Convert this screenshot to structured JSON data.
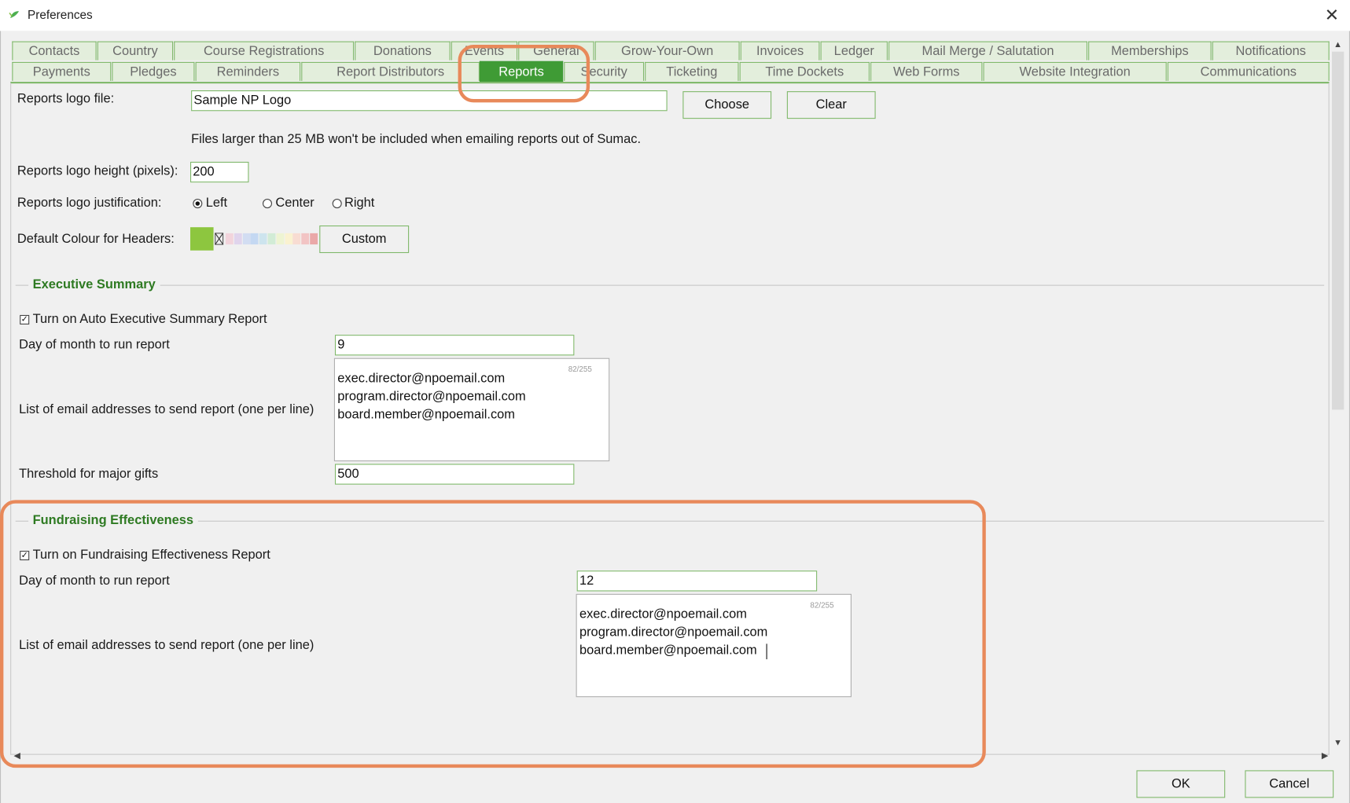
{
  "window": {
    "title": "Preferences",
    "close_glyph": "✕"
  },
  "tabs_row1": [
    "Contacts",
    "Country",
    "Course Registrations",
    "Donations",
    "Events",
    "General",
    "Grow-Your-Own",
    "Invoices",
    "Ledger",
    "Mail Merge / Salutation",
    "Memberships",
    "Notifications"
  ],
  "tabs_row2": [
    "Payments",
    "Pledges",
    "Reminders",
    "Report Distributors",
    "Reports",
    "Security",
    "Ticketing",
    "Time Dockets",
    "Web Forms",
    "Website Integration",
    "Communications"
  ],
  "active_tab": "Reports",
  "logo": {
    "file_label": "Reports logo file:",
    "file_value": "Sample NP Logo",
    "choose_label": "Choose",
    "clear_label": "Clear",
    "size_note": "Files larger than 25 MB won't be included when emailing reports out of Sumac.",
    "height_label": "Reports logo height (pixels):",
    "height_value": "200",
    "justification_label": "Reports logo justification:",
    "justification_options": [
      "Left",
      "Center",
      "Right"
    ],
    "justification_selected": "Left"
  },
  "header_colour": {
    "label": "Default Colour for Headers:",
    "selected_colour": "#8dc63f",
    "palette": [
      "#f2d4dc",
      "#e0d4ec",
      "#d2ddf2",
      "#c4d8f2",
      "#cde4ee",
      "#d2ecd6",
      "#eef4d2",
      "#faf2d0",
      "#f8dcd2",
      "#f2c4c4",
      "#eaa8a8"
    ],
    "custom_label": "Custom"
  },
  "executive_summary": {
    "title": "Executive Summary",
    "toggle_label": "Turn on Auto Executive Summary Report",
    "checked": true,
    "day_label": "Day of month to run report",
    "day_value": "9",
    "emails_label": "List of email addresses to send report (one per line)",
    "emails": [
      "exec.director@npoemail.com",
      "program.director@npoemail.com",
      "board.member@npoemail.com"
    ],
    "counter": "82/255",
    "threshold_label": "Threshold for major gifts",
    "threshold_value": "500"
  },
  "fundraising_effectiveness": {
    "title": "Fundraising Effectiveness",
    "toggle_label": "Turn on Fundraising Effectiveness Report",
    "checked": true,
    "day_label": "Day of month to run report",
    "day_value": "12",
    "emails_label": "List of email addresses to send report (one per line)",
    "emails": [
      "exec.director@npoemail.com",
      "program.director@npoemail.com",
      "board.member@npoemail.com"
    ],
    "counter": "82/255"
  },
  "footer": {
    "ok_label": "OK",
    "cancel_label": "Cancel"
  },
  "colors": {
    "accent": "#3f9b35",
    "tab_border": "#7fb86a",
    "highlight": "#e8895a",
    "section_title": "#2e7a22"
  }
}
